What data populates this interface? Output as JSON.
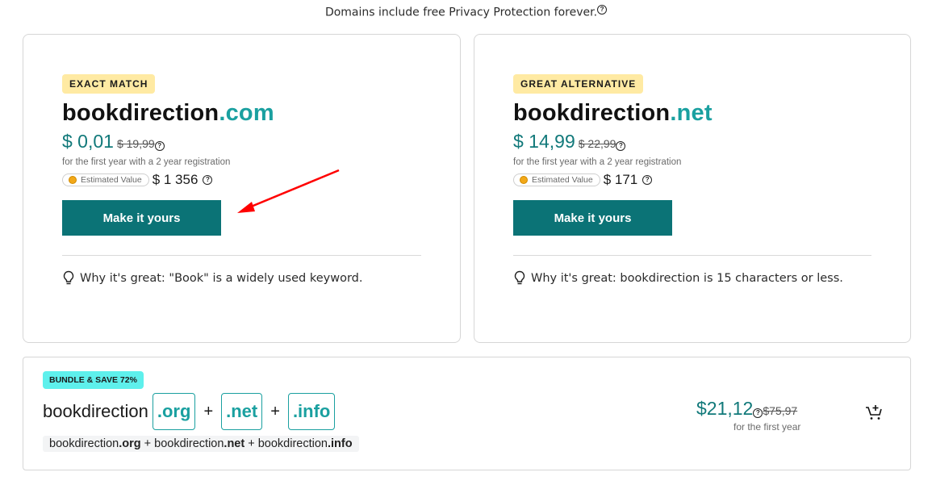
{
  "top_note": {
    "text": "Domains include free Privacy Protection forever.",
    "help_icon": "question-circle-icon"
  },
  "cards": [
    {
      "badge": "EXACT MATCH",
      "domain_name": "bookdirection",
      "tld": ".com",
      "price": "$ 0,01",
      "old_price": "$ 19,99",
      "price_note": "for the first year with a 2 year registration",
      "estimated_label": "Estimated Value",
      "estimated_value": "$ 1 356",
      "button_label": "Make it yours",
      "why": "Why it's great: \"Book\" is a widely used keyword."
    },
    {
      "badge": "GREAT ALTERNATIVE",
      "domain_name": "bookdirection",
      "tld": ".net",
      "price": "$ 14,99",
      "old_price": "$ 22,99",
      "price_note": "for the first year with a 2 year registration",
      "estimated_label": "Estimated Value",
      "estimated_value": "$ 171",
      "button_label": "Make it yours",
      "why": "Why it's great: bookdirection is 15 characters or less."
    }
  ],
  "bundle": {
    "badge": "BUNDLE & SAVE 72%",
    "base": "bookdirection",
    "tlds": [
      ".org",
      ".net",
      ".info"
    ],
    "plus": "+",
    "summary": [
      {
        "name": "bookdirection",
        "tld": ".org"
      },
      {
        "name": "bookdirection",
        "tld": ".net"
      },
      {
        "name": "bookdirection",
        "tld": ".info"
      }
    ],
    "price": "$21,12",
    "old_price": "$75,97",
    "price_note": "for the first year",
    "cart_icon": "add-to-cart-icon"
  },
  "colors": {
    "accent": "#0b7376",
    "tld": "#1aa0a0",
    "badge_yellow": "#ffeaa3",
    "badge_cyan": "#5ef0ec",
    "annotation_arrow": "#ff0000"
  }
}
